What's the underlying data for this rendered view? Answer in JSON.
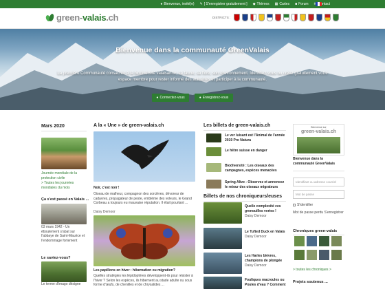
{
  "topbar": {
    "links": [
      {
        "label": "Bienvenue, invité(e)",
        "icon": "user-icon"
      },
      {
        "label": "[ S'enregistrer gratuitement ]",
        "icon": "register-icon"
      },
      {
        "label": "Thèmes",
        "icon": "themes-icon"
      },
      {
        "label": "Cartes",
        "icon": "map-icon"
      },
      {
        "label": "Forum",
        "icon": "forum-icon"
      },
      {
        "label": "Contact",
        "icon": "contact-icon"
      }
    ],
    "language": "FR"
  },
  "header": {
    "logo_prefix": "green-",
    "logo_brand": "valais",
    "logo_suffix": ".ch",
    "districts_label": "DISTRICTS :",
    "district_colors": [
      "#cc0000",
      "#1a3f8a",
      "#c41e1e",
      "#f2c21b",
      "#1a3f8a",
      "#c41e1e",
      "#2e7d32",
      "#c41e1e",
      "#f2c21b",
      "#c41e1e",
      "#1a3f8a",
      "#c41e1e",
      "#2e7d32"
    ]
  },
  "hero": {
    "title": "Bienvenue dans la communauté GreenValais",
    "text": "La première Communauté consacrée à la biodiversité valaisanne, sa faune, sa flore, son environnement. Identifiez-vous ou créez gratuitement votre espace membre pour rester informé des actualités et participer à la communauté.",
    "btn_login": "Connectez-vous",
    "btn_register": "Enregistrez-vous"
  },
  "left": {
    "month_title": "Mars 2020",
    "item1_text": "Journée mondiale de la protection civile",
    "item1_link": "> Toutes les journées mondiales du mois",
    "past_title": "Ça s'est passé en Valais ...",
    "past_text": "03 mars 1942 - Un éboulement s'abat sur l'abbaye de Saint-Maurice et l'endommage fortement",
    "know_title": "Le saviez-vous?",
    "know_text": "Le terme d'imago désigne"
  },
  "center": {
    "title": "A la « Une » de green-valais.ch",
    "article1_title": "Noir, c'est noir !",
    "article1_text": "Oiseau de malheur, compagnon des sorcières, dévoreur de cadavres, propagateur de peste, emblème des voleurs, le Grand Corbeau a toujours eu mauvaise réputation. Il était pourtant ...",
    "article1_author": "Daisy Demoor",
    "article2_title": "Les papillons en hiver : hibernation ou migration?",
    "article2_text": "Quelles stratégies les lépidoptères développent-ils pour résister à l'hiver ? Selon les espèces, ils hibernent au stade adulte ou sous forme d'œufs, de chenilles et de chrysalides ..."
  },
  "blog": {
    "title": "Les billets de green-valais.ch",
    "items": [
      {
        "text": "Le ver luisant est l'Animal de l'année 2019 Pro Natura"
      },
      {
        "text": "Le hêtre suisse en danger"
      },
      {
        "text": "Biodiversité : Les oiseaux des campagnes, espèces menacées"
      },
      {
        "text": "Spring Alive - Observez et annoncez le retour des oiseaux migrateurs"
      }
    ],
    "columns_title": "Billets de nos chroniqueurs/euses",
    "columns": [
      {
        "text": "Quelle complexité ces grenouilles vertes !",
        "author": "Daisy Demoor"
      },
      {
        "text": "Le Tufted Duck en Valais",
        "author": "Daisy Demoor"
      },
      {
        "text": "Les Harles bièvres, champions de plongée",
        "author": "Daisy Demoor"
      },
      {
        "text": "Fouliques macroules ou Poules d'eau ? Comment",
        "author": ""
      }
    ]
  },
  "sidebar": {
    "card_top": "Bienvenue sur",
    "card_brand": "green-valais.ch",
    "card_caption": "Bienvenue dans la communauté GreenValais",
    "login_placeholder": "Identifiant ou adresse courriel",
    "password_placeholder": "Mot de passe",
    "remember_label": "S'identifier",
    "forgot_text": "Mot de passe perdu S'enregistrer",
    "chron_title": "Chroniques green-valais",
    "chron_link": "> toutes les chroniques >",
    "projects_title": "Projets soutenus ..."
  }
}
